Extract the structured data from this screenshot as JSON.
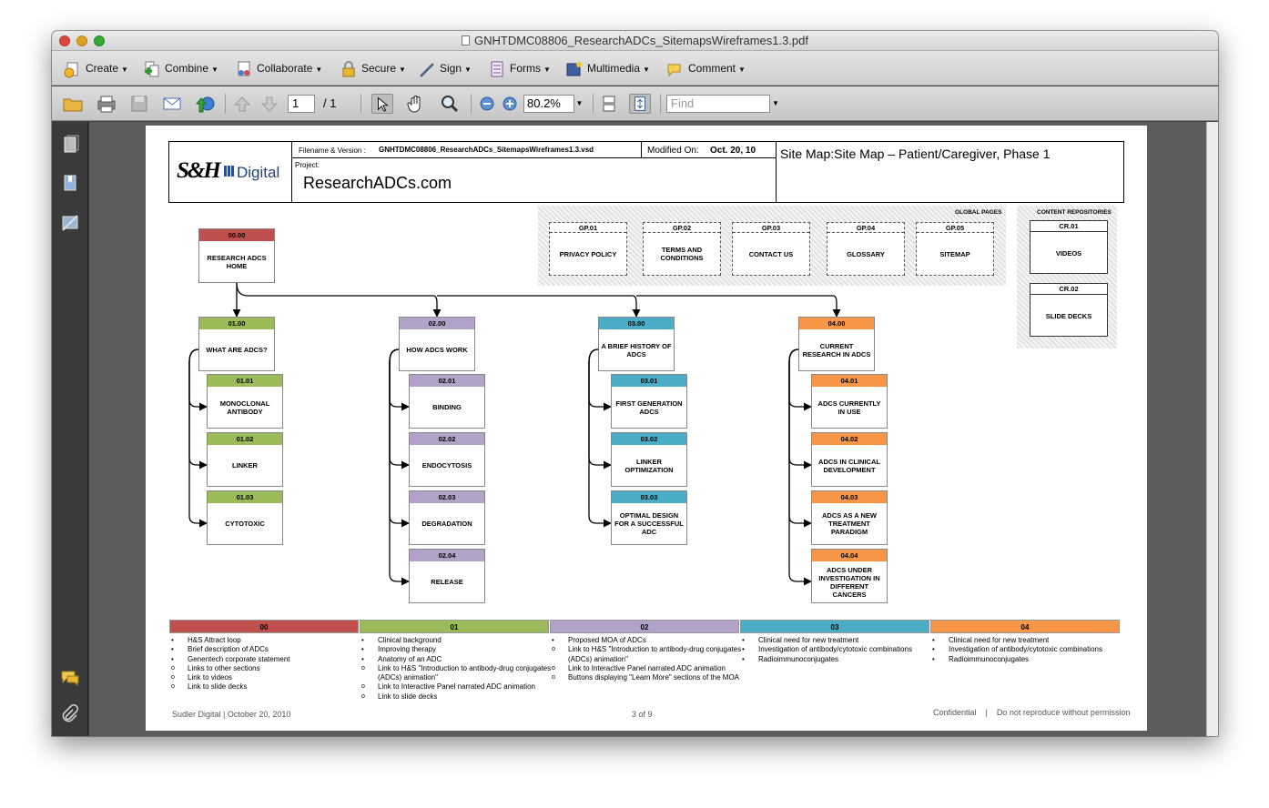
{
  "window": {
    "title": "GNHTDMC08806_ResearchADCs_SitemapsWireframes1.3.pdf"
  },
  "toolbar": {
    "create": "Create",
    "combine": "Combine",
    "collaborate": "Collaborate",
    "secure": "Secure",
    "sign": "Sign",
    "forms": "Forms",
    "multimedia": "Multimedia",
    "comment": "Comment"
  },
  "nav": {
    "page": "1",
    "total": "/ 1",
    "zoom": "80.2%",
    "find_placeholder": "Find"
  },
  "doc": {
    "logo": "S&H",
    "logo_digital": "Digital",
    "filename_label": "Filename & Version :",
    "filename": "GNHTDMC08806_ResearchADCs_SitemapsWireframes1.3.vsd",
    "modified_label": "Modified On:",
    "modified": "Oct. 20, 10",
    "project_label": "Project:",
    "project": "ResearchADCs.com",
    "sitemap_title": "Site Map:Site Map – Patient/Caregiver, Phase 1",
    "global_pages_label": "GLOBAL PAGES",
    "content_repos_label": "CONTENT REPOSITORIES",
    "global_pages": [
      {
        "id": "GP.01",
        "label": "PRIVACY POLICY"
      },
      {
        "id": "GP.02",
        "label": "TERMS AND CONDITIONS"
      },
      {
        "id": "GP.03",
        "label": "CONTACT US"
      },
      {
        "id": "GP.04",
        "label": "GLOSSARY"
      },
      {
        "id": "GP.05",
        "label": "SITEMAP"
      }
    ],
    "repos": [
      {
        "id": "CR.01",
        "label": "VIDEOS"
      },
      {
        "id": "CR.02",
        "label": "SLIDE DECKS"
      }
    ],
    "home": {
      "id": "00.00",
      "label": "RESEARCH ADCS HOME"
    },
    "sections": [
      {
        "id": "01.00",
        "label": "WHAT ARE ADCS?",
        "children": [
          {
            "id": "01.01",
            "label": "MONOCLONAL ANTIBODY"
          },
          {
            "id": "01.02",
            "label": "LINKER"
          },
          {
            "id": "01.03",
            "label": "CYTOTOXIC"
          }
        ]
      },
      {
        "id": "02.00",
        "label": "HOW ADCS WORK",
        "children": [
          {
            "id": "02.01",
            "label": "BINDING"
          },
          {
            "id": "02.02",
            "label": "ENDOCYTOSIS"
          },
          {
            "id": "02.03",
            "label": "DEGRADATION"
          },
          {
            "id": "02.04",
            "label": "RELEASE"
          }
        ]
      },
      {
        "id": "03.00",
        "label": "A BRIEF HISTORY OF ADCS",
        "children": [
          {
            "id": "03.01",
            "label": "FIRST GENERATION ADCS"
          },
          {
            "id": "03.02",
            "label": "LINKER OPTIMIZATION"
          },
          {
            "id": "03.03",
            "label": "OPTIMAL DESIGN FOR A SUCCESSFUL ADC"
          }
        ]
      },
      {
        "id": "04.00",
        "label": "CURRENT RESEARCH IN ADCS",
        "children": [
          {
            "id": "04.01",
            "label": "ADCS CURRENTLY IN USE"
          },
          {
            "id": "04.02",
            "label": "ADCS IN CLINICAL DEVELOPMENT"
          },
          {
            "id": "04.03",
            "label": "ADCS AS A NEW TREATMENT PARADIGM"
          },
          {
            "id": "04.04",
            "label": "ADCS UNDER INVESTIGATION IN DIFFERENT CANCERS"
          }
        ]
      }
    ],
    "legend": [
      {
        "id": "00",
        "items": [
          {
            "bullet": "b",
            "text": "H&S Attract loop"
          },
          {
            "bullet": "b",
            "text": "Brief description of ADCs"
          },
          {
            "bullet": "b",
            "text": "Genentech corporate statement"
          },
          {
            "bullet": "o",
            "text": "Links to other sections"
          },
          {
            "bullet": "o",
            "text": "Link to videos"
          },
          {
            "bullet": "o",
            "text": "Link to slide decks"
          }
        ]
      },
      {
        "id": "01",
        "items": [
          {
            "bullet": "b",
            "text": "Clinical background"
          },
          {
            "bullet": "b",
            "text": "Improving therapy"
          },
          {
            "bullet": "b",
            "text": "Anatomy of an ADC"
          },
          {
            "bullet": "o",
            "text": "Link to H&S \"Introduction to antibody-drug conjugates"
          },
          {
            "bullet": "",
            "text": "(ADCs) animation\""
          },
          {
            "bullet": "o",
            "text": "Link to Interactive Panel narrated ADC animation"
          },
          {
            "bullet": "o",
            "text": "Link to slide decks"
          }
        ]
      },
      {
        "id": "02",
        "items": [
          {
            "bullet": "b",
            "text": "Proposed MOA of ADCs"
          },
          {
            "bullet": "o",
            "text": "Link to H&S \"Introduction to antibody-drug conjugates"
          },
          {
            "bullet": "",
            "text": "(ADCs) animation\""
          },
          {
            "bullet": "o",
            "text": "Link to Interactive Panel narrated ADC animation"
          },
          {
            "bullet": "o",
            "text": "Buttons displaying \"Learn More\" sections of the MOA"
          }
        ]
      },
      {
        "id": "03",
        "items": [
          {
            "bullet": "b",
            "text": "Clinical need for new treatment"
          },
          {
            "bullet": "b",
            "text": "Investigation of antibody/cytotoxic combinations"
          },
          {
            "bullet": "b",
            "text": "Radioimmunoconjugates"
          }
        ]
      },
      {
        "id": "04",
        "items": [
          {
            "bullet": "b",
            "text": "Clinical need for new treatment"
          },
          {
            "bullet": "b",
            "text": "Investigation of antibody/cytotoxic combinations"
          },
          {
            "bullet": "b",
            "text": "Radioimmunoconjugates"
          }
        ]
      }
    ],
    "colors": {
      "c00": "#c0504d",
      "c01": "#9bbb59",
      "c02": "#b3a2c7",
      "c03": "#4bacc6",
      "c04": "#f79646"
    },
    "footer_left": "Sudler Digital  |  October 20, 2010",
    "footer_page": "3  of  9",
    "footer_right": "Confidential    |    Do not reproduce without permission"
  }
}
